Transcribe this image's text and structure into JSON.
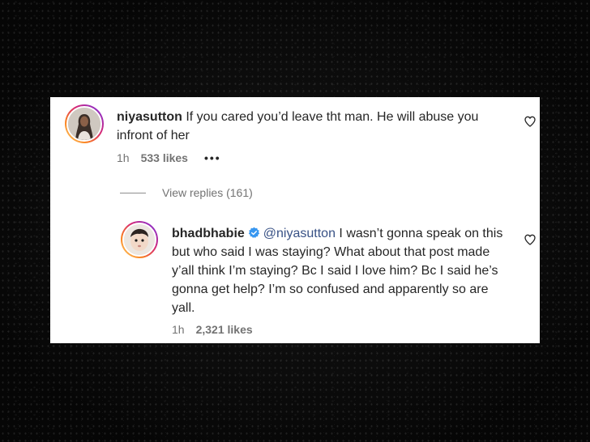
{
  "comment": {
    "username": "niyasutton",
    "text": "If you cared you’d leave tht man. He will abuse you infront of her",
    "time": "1h",
    "likes": "533 likes",
    "more": "•••",
    "avatar_icon": "profile-photo"
  },
  "view_replies": {
    "label": "View replies (161)"
  },
  "reply": {
    "username": "bhadbhabie",
    "verified": true,
    "mention": "@niyasutton",
    "text": "I wasn’t gonna speak on this but who said I was staying? What about that post made y’all think I’m staying? Bc I said I love him? Bc I said he’s gonna get help? I’m so confused and apparently so are yall.",
    "time": "1h",
    "likes": "2,321 likes",
    "avatar_icon": "profile-photo"
  },
  "colors": {
    "verified_badge": "#3897f0",
    "mention": "#385185",
    "text": "#262626",
    "meta": "#737373"
  }
}
